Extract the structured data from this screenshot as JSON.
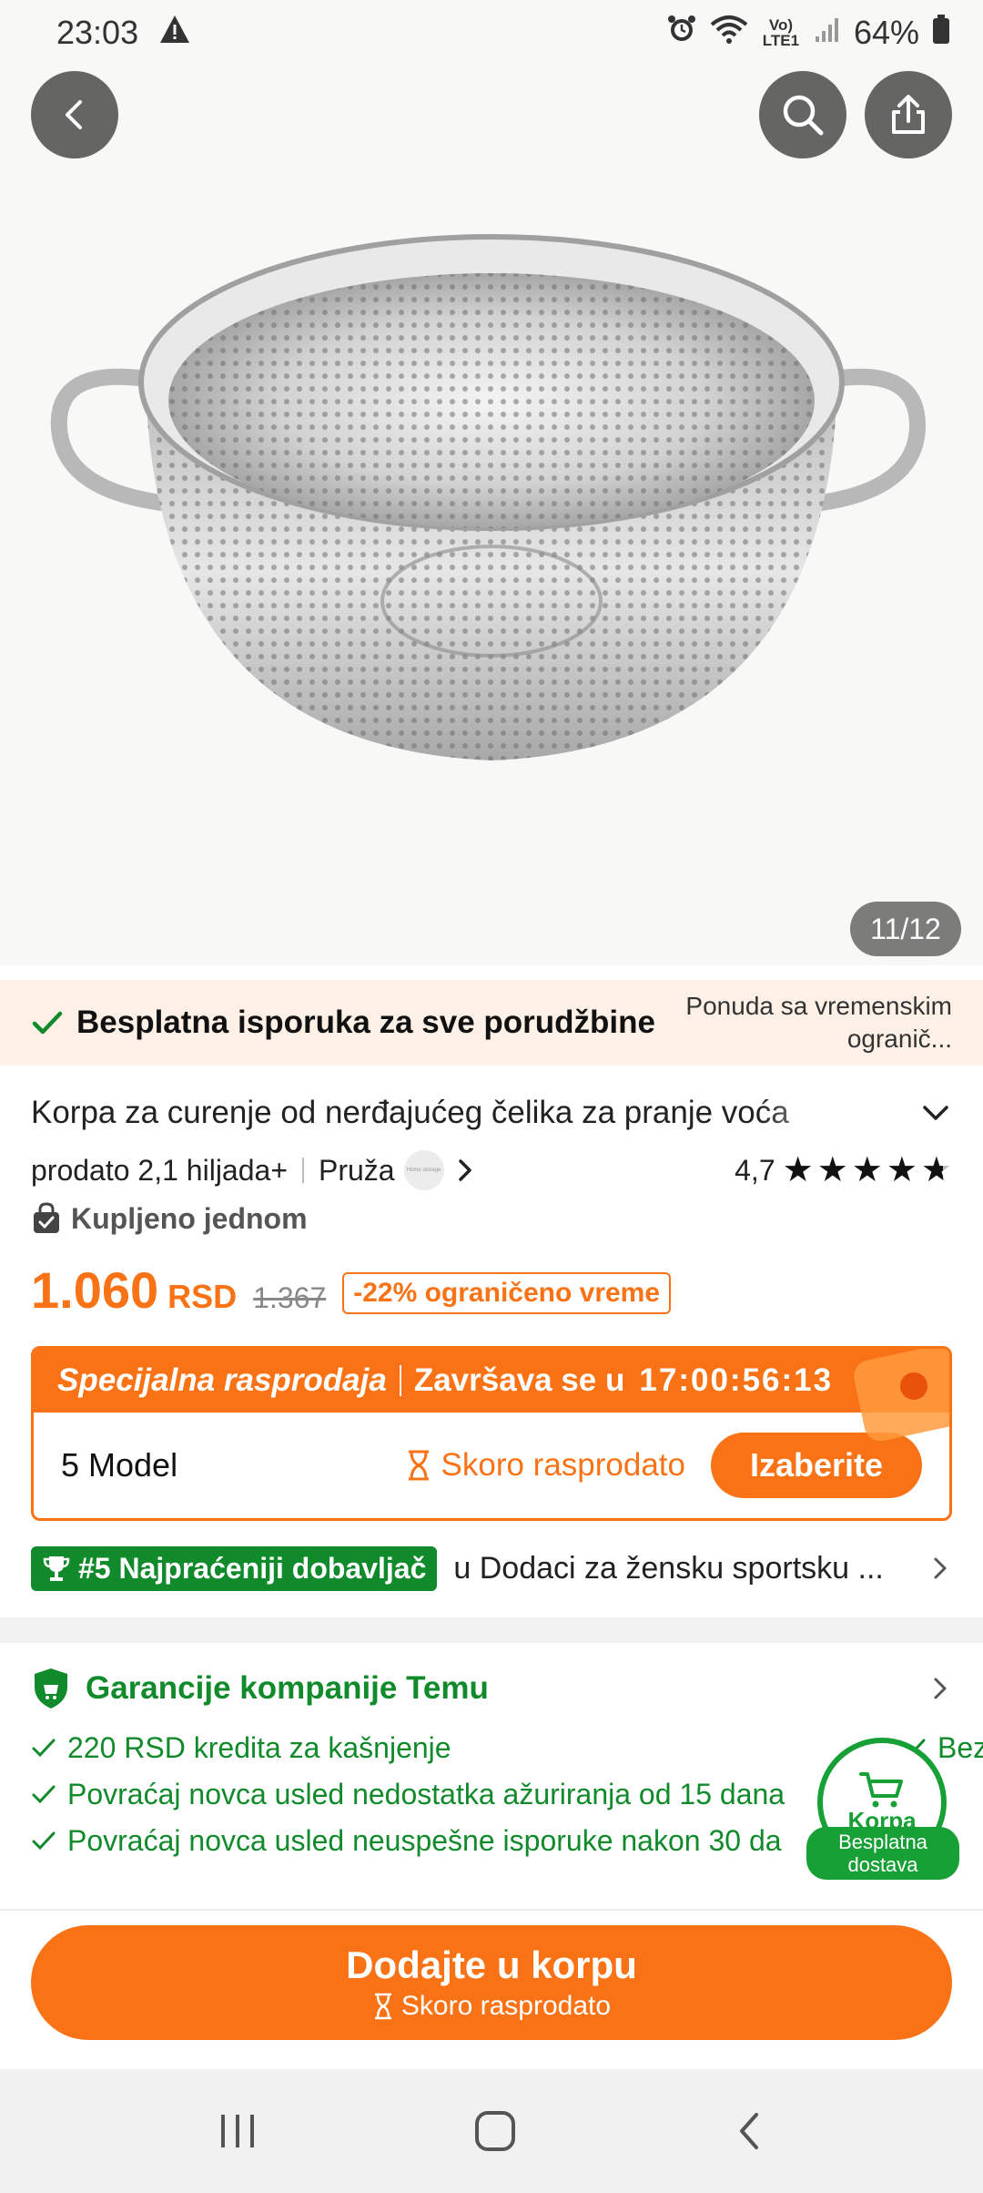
{
  "status_bar": {
    "time": "23:03",
    "network": "Vo) LTE1",
    "battery": "64%"
  },
  "gallery": {
    "counter": "11/12"
  },
  "shipping_banner": {
    "title": "Besplatna isporuka za sve porudžbine",
    "offer": "Ponuda sa vremenskim ogranič..."
  },
  "product": {
    "title": "Korpa za curenje od nerđajućeg čelika za pranje voća",
    "sold": "prodato 2,1 hiljada+",
    "provider_label": "Pruža",
    "seller_logo_text": "Home storage",
    "rating": "4,7",
    "rating_value": 4.7,
    "bought_label": "Kupljeno jednom",
    "price": "1.060",
    "currency": "RSD",
    "old_price": "1.367",
    "discount": "-22% ograničeno vreme"
  },
  "flash_sale": {
    "title": "Specijalna rasprodaja",
    "ends_label": "Završava se u",
    "countdown": "17:00:56:13",
    "model": "5 Model",
    "stock_status": "Skoro rasprodato",
    "select_label": "Izaberite"
  },
  "ranking": {
    "badge": "#5 Najpraćeniji dobavljač",
    "category": "u Dodaci za žensku sportsku ..."
  },
  "guarantees": {
    "title": "Garancije kompanije Temu",
    "items": [
      "220 RSD kredita za kašnjenje",
      "Povraćaj novca usled nedostatka ažuriranja od 15 dana",
      "Povraćaj novca usled neuspešne isporuke nakon 30 da"
    ],
    "side_partial": "Bezi"
  },
  "cart_fab": {
    "label": "Korpa",
    "free_shipping": "Besplatna dostava"
  },
  "add_to_cart": {
    "label": "Dodajte u korpu",
    "sub_label": "Skoro rasprodato"
  },
  "colors": {
    "accent_orange": "#f97316",
    "green": "#118a2b",
    "banner_bg": "#fdf0e6"
  },
  "icons": [
    "back-icon",
    "search-icon",
    "share-icon",
    "check-icon",
    "lock-bag-icon",
    "hourglass-icon",
    "trophy-icon",
    "shield-icon",
    "cart-icon",
    "chevron-right-icon",
    "chevron-down-icon"
  ]
}
